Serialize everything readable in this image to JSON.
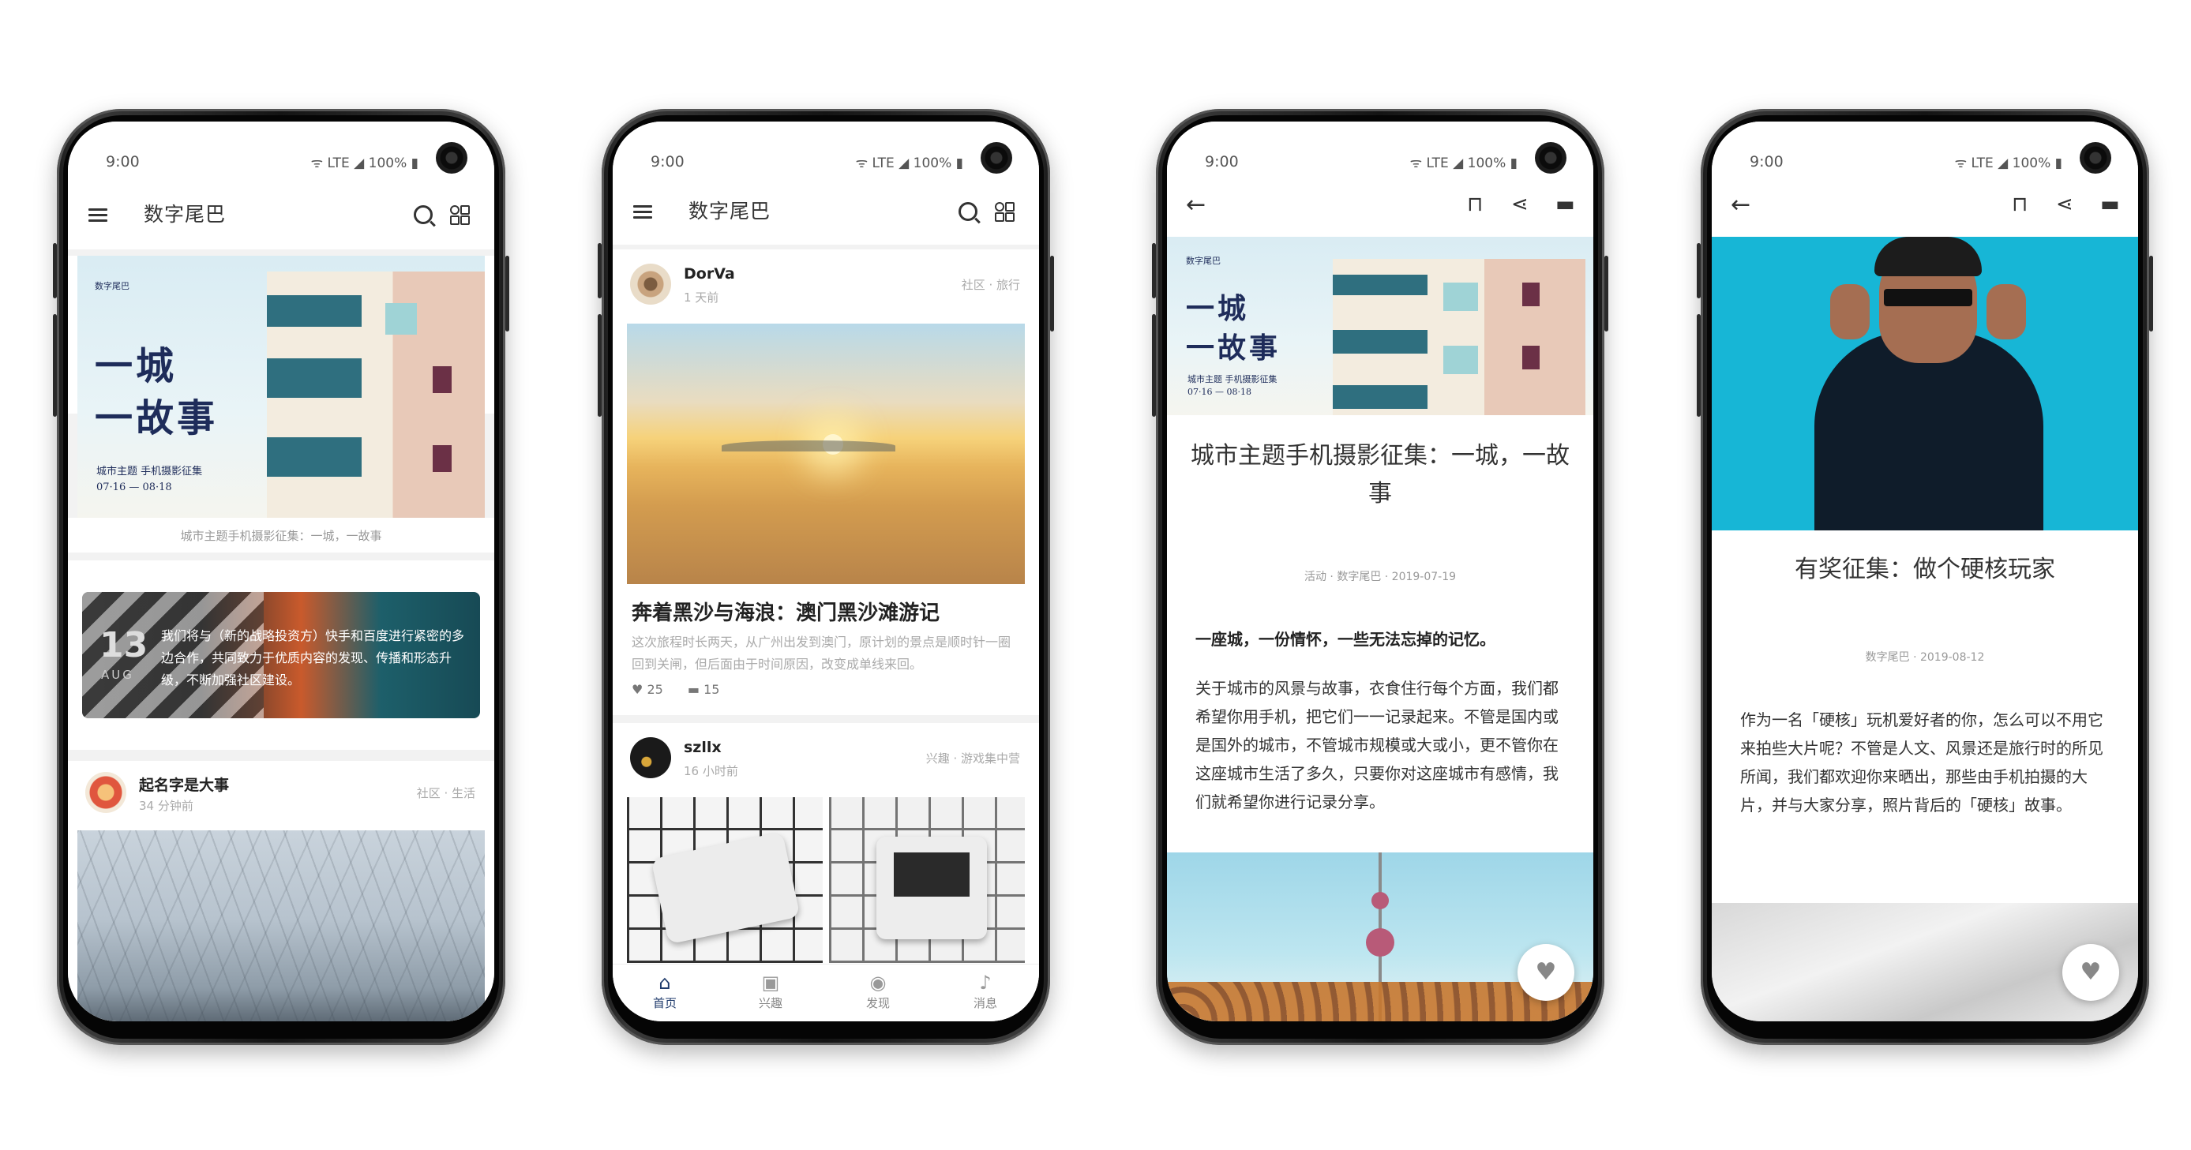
{
  "status": {
    "time": "9:00",
    "signal": "ᯤ LTE ◢ 100% ▮"
  },
  "phone1": {
    "app_title": "数字尾巴",
    "poster": {
      "logo": "数字尾巴",
      "line1": "一城",
      "line2": "一故事",
      "theme": "城市主题  手机摄影征集",
      "dates": "07·16 — 08·18"
    },
    "poster_caption": "城市主题手机摄影征集：一城，一故事",
    "banner": {
      "day": "13",
      "month": "AUG",
      "text": "我们将与（新的战略投资方）快手和百度进行紧密的多边合作，共同致力于优质内容的发现、传播和形态升级，不断加强社区建设。"
    },
    "post": {
      "author": "起名字是大事",
      "time_ago": "34 分钟前",
      "tag": "社区 · 生活"
    }
  },
  "phone2": {
    "app_title": "数字尾巴",
    "post1": {
      "author": "DorVa",
      "time_ago": "1 天前",
      "tag": "社区 · 旅行",
      "title": "奔着黑沙与海浪：澳门黑沙滩游记",
      "desc": "这次旅程时长两天，从广州出发到澳门，原计划的景点是顺时针一圈回到关闸，但后面由于时间原因，改变成单线来回。",
      "likes": "25",
      "comments": "15"
    },
    "post2": {
      "author": "szllx",
      "time_ago": "16 小时前",
      "tag": "兴趣 · 游戏集中营"
    },
    "nav": [
      "首页",
      "兴趣",
      "发现",
      "消息"
    ]
  },
  "phone3": {
    "poster": {
      "logo": "数字尾巴",
      "line1": "一城",
      "line2": "一故事",
      "theme": "城市主题  手机摄影征集",
      "dates": "07·16 — 08·18"
    },
    "title": "城市主题手机摄影征集：一城，一故事",
    "meta": "活动 · 数字尾巴 · 2019-07-19",
    "lead": "一座城，一份情怀，一些无法忘掉的记忆。",
    "body": "关于城市的风景与故事，衣食住行每个方面，我们都希望你用手机，把它们一一记录起来。不管是国内或是国外的城市，不管城市规模或大或小，更不管你在这座城市生活了多久，只要你对这座城市有感情，我们就希望你进行记录分享。"
  },
  "phone4": {
    "title": "有奖征集：做个硬核玩家",
    "meta": "数字尾巴 · 2019-08-12",
    "body": "作为一名「硬核」玩机爱好者的你，怎么可以不用它来拍些大片呢？不管是人文、风景还是旅行时的所见所闻，我们都欢迎你来晒出，那些由手机拍摄的大片，并与大家分享，照片背后的「硬核」故事。"
  },
  "colors": {
    "accent": "#1e3a6b",
    "poster_navy": "#1e2c5a",
    "cyan_bg": "#17b6d6"
  }
}
